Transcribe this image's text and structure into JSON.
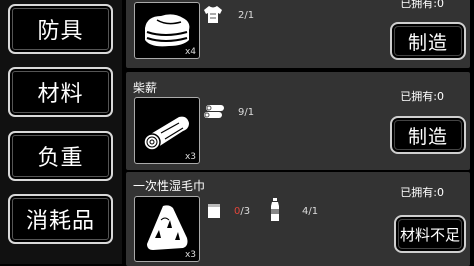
{
  "sidebar": {
    "items": [
      {
        "label": "防具"
      },
      {
        "label": "材料"
      },
      {
        "label": "负重"
      },
      {
        "label": "消耗品"
      }
    ]
  },
  "recipes": [
    {
      "name": "",
      "owned": "已拥有:0",
      "thumb_icon": "folded-cloth-icon",
      "qty": "x4",
      "materials": [
        {
          "icon": "shirt-icon",
          "count": "2/1"
        }
      ],
      "button": "制造"
    },
    {
      "name": "柴薪",
      "owned": "已拥有:0",
      "thumb_icon": "log-icon",
      "qty": "x3",
      "materials": [
        {
          "icon": "wood-logs-icon",
          "count": "9/1"
        }
      ],
      "button": "制造"
    },
    {
      "name": "一次性湿毛巾",
      "owned": "已拥有:0",
      "thumb_icon": "wet-towel-icon",
      "qty": "x3",
      "materials": [
        {
          "icon": "towel-icon",
          "have": "0",
          "need": "/3"
        },
        {
          "icon": "water-bottle-icon",
          "count": "4/1"
        }
      ],
      "button": "材料不足"
    }
  ],
  "colors": {
    "background": "#000000",
    "card": "#333333",
    "lack": "#e0453a"
  }
}
